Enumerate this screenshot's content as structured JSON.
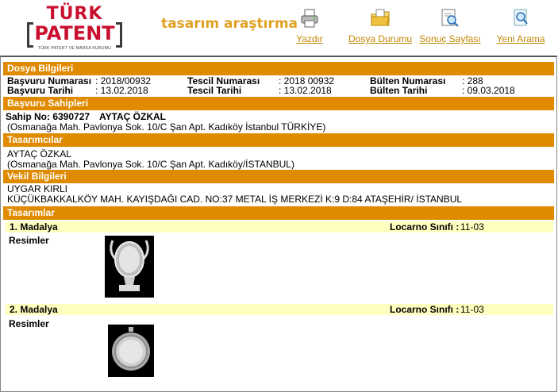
{
  "logo": {
    "line1": "TÜRK",
    "line2": "PATENT",
    "sub": "TÜRK PATENT VE MARKA KURUMU"
  },
  "app_title": "tasarım araştırma",
  "nav": [
    {
      "label": "Yazdır",
      "icon": "printer-icon"
    },
    {
      "label": "Dosya Durumu",
      "icon": "folder-icon"
    },
    {
      "label": "Sonuç Sayfası",
      "icon": "results-icon"
    },
    {
      "label": "Yeni Arama",
      "icon": "search-icon"
    }
  ],
  "colors": {
    "section_bar": "#e08a00",
    "item_bar": "#ffffc0",
    "accent": "#e0a020",
    "logo_red": "#c8102e"
  },
  "dosya": {
    "title": "Dosya Bilgileri",
    "basvuru_no_label": "Başvuru Numarası",
    "basvuru_no": ": 2018/00932",
    "basvuru_tarihi_label": "Başvuru Tarihi",
    "basvuru_tarihi": ": 13.02.2018",
    "tescil_no_label": "Tescil Numarası",
    "tescil_no": ": 2018 00932",
    "tescil_tarihi_label": "Tescil Tarihi",
    "tescil_tarihi": ": 13.02.2018",
    "bulten_no_label": "Bülten Numarası",
    "bulten_no": ": 288",
    "bulten_tarihi_label": "Bülten Tarihi",
    "bulten_tarihi": ": 09.03.2018"
  },
  "sahipler": {
    "title": "Başvuru Sahipleri",
    "sahip_no_label": "Sahip No: 6390727",
    "name": "AYTAÇ ÖZKAL",
    "address": "(Osmanağa Mah. Pavlonya Sok. 10/C Şan Apt. Kadıköy İstanbul TÜRKİYE)"
  },
  "tasarimcilar": {
    "title": "Tasarımcılar",
    "name": "AYTAÇ ÖZKAL",
    "address": "(Osmanağa Mah. Pavlonya Sok. 10/C Şan Apt. Kadıköy/İSTANBUL)"
  },
  "vekil": {
    "title": "Vekil Bilgileri",
    "name": "UYGAR KIRLI",
    "address": "KÜÇÜKBAKKALKÖY MAH. KAYIŞDAĞI CAD. NO:37 METAL İŞ MERKEZİ K:9 D:84 ATAŞEHİR/ İSTANBUL"
  },
  "tasarimlar": {
    "title": "Tasarımlar",
    "items": [
      {
        "name": "1. Madalya",
        "locarno_label": "Locarno Sınıfı :",
        "locarno_value": "11-03",
        "images_label": "Resimler"
      },
      {
        "name": "2. Madalya",
        "locarno_label": "Locarno Sınıfı :",
        "locarno_value": "11-03",
        "images_label": "Resimler"
      }
    ]
  }
}
